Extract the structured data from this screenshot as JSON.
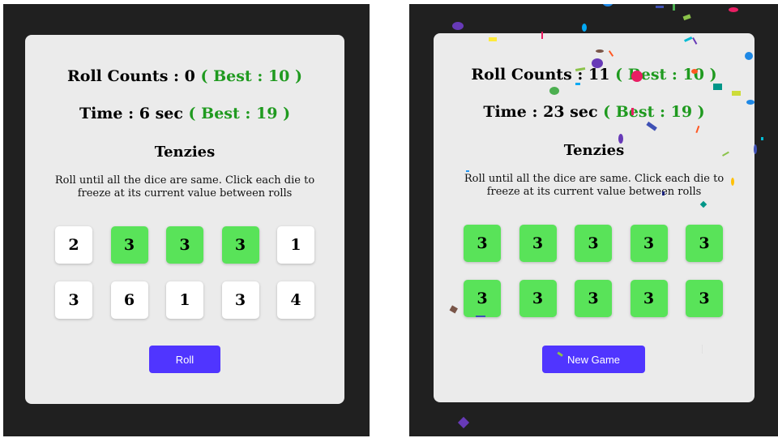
{
  "games": [
    {
      "stats": {
        "rolls_label": "Roll Counts : 0",
        "rolls_best": "( Best : 10 )",
        "time_label": "Time : 6 sec",
        "time_best": "( Best : 19 )"
      },
      "title": "Tenzies",
      "instructions": "Roll until all the dice are same. Click each die to freeze at its current value between rolls",
      "dice": [
        {
          "value": "2",
          "held": false
        },
        {
          "value": "3",
          "held": true
        },
        {
          "value": "3",
          "held": true
        },
        {
          "value": "3",
          "held": true
        },
        {
          "value": "1",
          "held": false
        },
        {
          "value": "3",
          "held": false
        },
        {
          "value": "6",
          "held": false
        },
        {
          "value": "1",
          "held": false
        },
        {
          "value": "3",
          "held": false
        },
        {
          "value": "4",
          "held": false
        }
      ],
      "button_label": "Roll"
    },
    {
      "stats": {
        "rolls_label": "Roll Counts : 11",
        "rolls_best": "( Best : 10 )",
        "time_label": "Time : 23 sec",
        "time_best": "( Best : 19 )"
      },
      "title": "Tenzies",
      "instructions": "Roll until all the dice are same. Click each die to freeze at its current value between rolls",
      "dice": [
        {
          "value": "3",
          "held": true
        },
        {
          "value": "3",
          "held": true
        },
        {
          "value": "3",
          "held": true
        },
        {
          "value": "3",
          "held": true
        },
        {
          "value": "3",
          "held": true
        },
        {
          "value": "3",
          "held": true
        },
        {
          "value": "3",
          "held": true
        },
        {
          "value": "3",
          "held": true
        },
        {
          "value": "3",
          "held": true
        },
        {
          "value": "3",
          "held": true
        }
      ],
      "button_label": "New Game"
    }
  ],
  "colors": {
    "background": "#202020",
    "card": "#ebebeb",
    "held_die": "#59e359",
    "free_die": "#ffffff",
    "best_text": "#1f9a1f",
    "button": "#5035ff"
  }
}
